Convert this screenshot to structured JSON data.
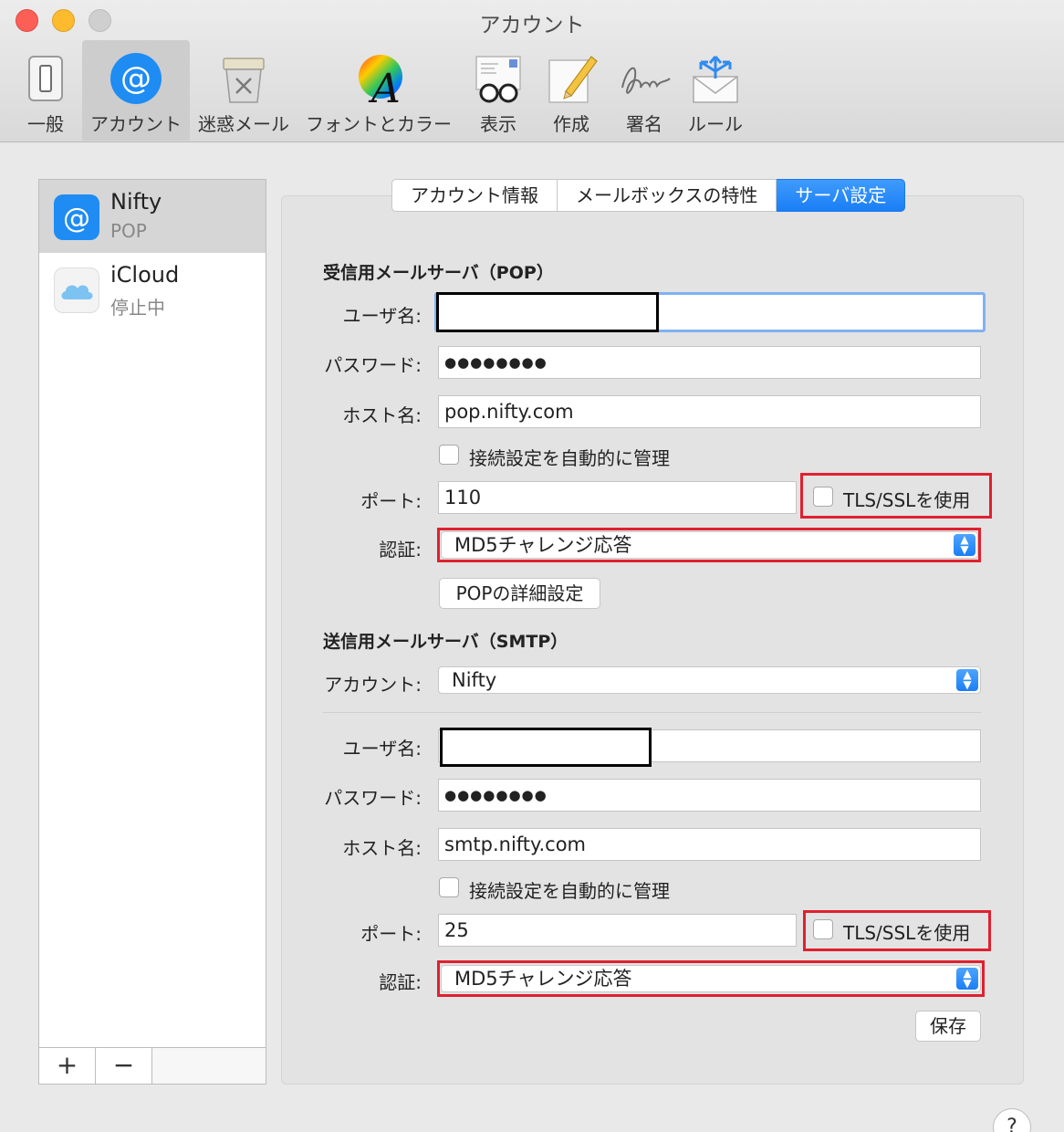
{
  "window": {
    "title": "アカウント"
  },
  "toolbar": {
    "items": [
      {
        "label": "一般",
        "icon": "general-switch-icon"
      },
      {
        "label": "アカウント",
        "icon": "at-sign-icon"
      },
      {
        "label": "迷惑メール",
        "icon": "junk-trash-icon"
      },
      {
        "label": "フォントとカラー",
        "icon": "font-color-icon"
      },
      {
        "label": "表示",
        "icon": "viewing-glasses-icon"
      },
      {
        "label": "作成",
        "icon": "compose-pencil-icon"
      },
      {
        "label": "署名",
        "icon": "signature-icon"
      },
      {
        "label": "ルール",
        "icon": "rules-envelope-icon"
      }
    ],
    "selected": "アカウント"
  },
  "sidebar": {
    "accounts": [
      {
        "name": "Nifty",
        "subtitle": "POP",
        "icon": "at-sign-icon"
      },
      {
        "name": "iCloud",
        "subtitle": "停止中",
        "icon": "icloud-icon"
      }
    ],
    "add_label": "+",
    "remove_label": "−"
  },
  "tabs": {
    "items": [
      "アカウント情報",
      "メールボックスの特性",
      "サーバ設定"
    ],
    "active": "サーバ設定"
  },
  "incoming": {
    "title": "受信用メールサーバ（POP）",
    "username_label": "ユーザ名:",
    "username_value": "",
    "password_label": "パスワード:",
    "password_value": "●●●●●●●●",
    "host_label": "ホスト名:",
    "host_value": "pop.nifty.com",
    "auto_manage_label": "接続設定を自動的に管理",
    "auto_manage_checked": false,
    "port_label": "ポート:",
    "port_value": "110",
    "tls_label": "TLS/SSLを使用",
    "tls_checked": false,
    "auth_label": "認証:",
    "auth_value": "MD5チャレンジ応答",
    "advanced_button": "POPの詳細設定"
  },
  "outgoing": {
    "title": "送信用メールサーバ（SMTP）",
    "account_label": "アカウント:",
    "account_value": "Nifty",
    "username_label": "ユーザ名:",
    "username_value": "",
    "password_label": "パスワード:",
    "password_value": "●●●●●●●●",
    "host_label": "ホスト名:",
    "host_value": "smtp.nifty.com",
    "auto_manage_label": "接続設定を自動的に管理",
    "auto_manage_checked": false,
    "port_label": "ポート:",
    "port_value": "25",
    "tls_label": "TLS/SSLを使用",
    "tls_checked": false,
    "auth_label": "認証:",
    "auth_value": "MD5チャレンジ応答"
  },
  "save_button": "保存",
  "help_button": "?",
  "colors": {
    "accent": "#1a7ef6",
    "highlight": "#e0202f",
    "traffic_red": "#fd5f57",
    "traffic_yellow": "#febb2e"
  }
}
